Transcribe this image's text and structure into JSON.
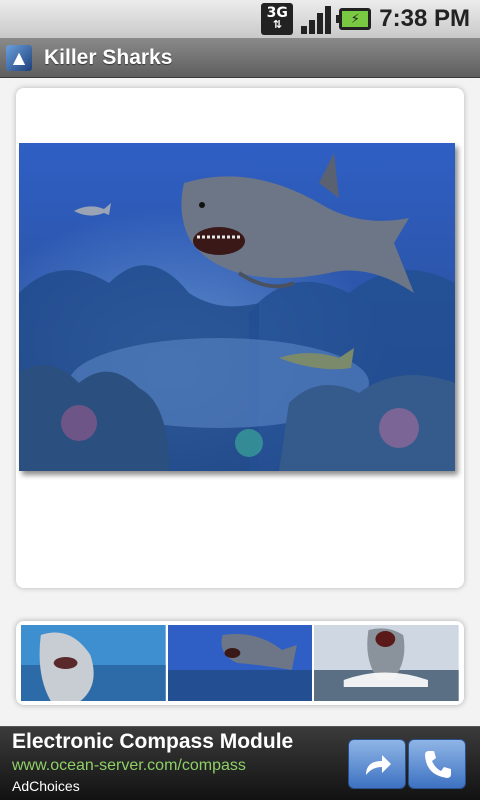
{
  "status_bar": {
    "network": "3G",
    "time": "7:38 PM"
  },
  "title_bar": {
    "app_title": "Killer Sharks",
    "icon": "shark-app-icon"
  },
  "gallery": {
    "main_image": "shark-photo-main",
    "thumbnails": [
      "shark-thumbnail-1",
      "shark-thumbnail-2",
      "shark-thumbnail-3"
    ]
  },
  "ad": {
    "title": "Electronic Compass Module",
    "url": "www.ocean-server.com/compass",
    "choices": "AdChoices",
    "buttons": [
      "share-arrow-icon",
      "phone-icon"
    ]
  },
  "colors": {
    "ad_url": "#8ed066",
    "ad_button": "#5a8bd4"
  }
}
